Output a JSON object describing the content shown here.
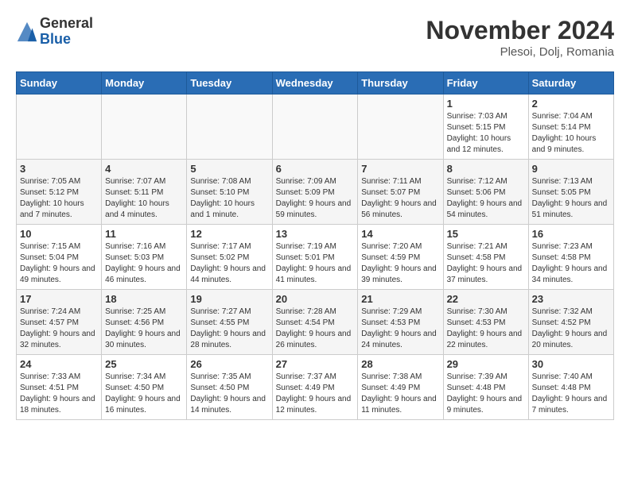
{
  "logo": {
    "general": "General",
    "blue": "Blue"
  },
  "title": "November 2024",
  "location": "Plesoi, Dolj, Romania",
  "days_of_week": [
    "Sunday",
    "Monday",
    "Tuesday",
    "Wednesday",
    "Thursday",
    "Friday",
    "Saturday"
  ],
  "weeks": [
    [
      {
        "day": "",
        "info": ""
      },
      {
        "day": "",
        "info": ""
      },
      {
        "day": "",
        "info": ""
      },
      {
        "day": "",
        "info": ""
      },
      {
        "day": "",
        "info": ""
      },
      {
        "day": "1",
        "info": "Sunrise: 7:03 AM\nSunset: 5:15 PM\nDaylight: 10 hours and 12 minutes."
      },
      {
        "day": "2",
        "info": "Sunrise: 7:04 AM\nSunset: 5:14 PM\nDaylight: 10 hours and 9 minutes."
      }
    ],
    [
      {
        "day": "3",
        "info": "Sunrise: 7:05 AM\nSunset: 5:12 PM\nDaylight: 10 hours and 7 minutes."
      },
      {
        "day": "4",
        "info": "Sunrise: 7:07 AM\nSunset: 5:11 PM\nDaylight: 10 hours and 4 minutes."
      },
      {
        "day": "5",
        "info": "Sunrise: 7:08 AM\nSunset: 5:10 PM\nDaylight: 10 hours and 1 minute."
      },
      {
        "day": "6",
        "info": "Sunrise: 7:09 AM\nSunset: 5:09 PM\nDaylight: 9 hours and 59 minutes."
      },
      {
        "day": "7",
        "info": "Sunrise: 7:11 AM\nSunset: 5:07 PM\nDaylight: 9 hours and 56 minutes."
      },
      {
        "day": "8",
        "info": "Sunrise: 7:12 AM\nSunset: 5:06 PM\nDaylight: 9 hours and 54 minutes."
      },
      {
        "day": "9",
        "info": "Sunrise: 7:13 AM\nSunset: 5:05 PM\nDaylight: 9 hours and 51 minutes."
      }
    ],
    [
      {
        "day": "10",
        "info": "Sunrise: 7:15 AM\nSunset: 5:04 PM\nDaylight: 9 hours and 49 minutes."
      },
      {
        "day": "11",
        "info": "Sunrise: 7:16 AM\nSunset: 5:03 PM\nDaylight: 9 hours and 46 minutes."
      },
      {
        "day": "12",
        "info": "Sunrise: 7:17 AM\nSunset: 5:02 PM\nDaylight: 9 hours and 44 minutes."
      },
      {
        "day": "13",
        "info": "Sunrise: 7:19 AM\nSunset: 5:01 PM\nDaylight: 9 hours and 41 minutes."
      },
      {
        "day": "14",
        "info": "Sunrise: 7:20 AM\nSunset: 4:59 PM\nDaylight: 9 hours and 39 minutes."
      },
      {
        "day": "15",
        "info": "Sunrise: 7:21 AM\nSunset: 4:58 PM\nDaylight: 9 hours and 37 minutes."
      },
      {
        "day": "16",
        "info": "Sunrise: 7:23 AM\nSunset: 4:58 PM\nDaylight: 9 hours and 34 minutes."
      }
    ],
    [
      {
        "day": "17",
        "info": "Sunrise: 7:24 AM\nSunset: 4:57 PM\nDaylight: 9 hours and 32 minutes."
      },
      {
        "day": "18",
        "info": "Sunrise: 7:25 AM\nSunset: 4:56 PM\nDaylight: 9 hours and 30 minutes."
      },
      {
        "day": "19",
        "info": "Sunrise: 7:27 AM\nSunset: 4:55 PM\nDaylight: 9 hours and 28 minutes."
      },
      {
        "day": "20",
        "info": "Sunrise: 7:28 AM\nSunset: 4:54 PM\nDaylight: 9 hours and 26 minutes."
      },
      {
        "day": "21",
        "info": "Sunrise: 7:29 AM\nSunset: 4:53 PM\nDaylight: 9 hours and 24 minutes."
      },
      {
        "day": "22",
        "info": "Sunrise: 7:30 AM\nSunset: 4:53 PM\nDaylight: 9 hours and 22 minutes."
      },
      {
        "day": "23",
        "info": "Sunrise: 7:32 AM\nSunset: 4:52 PM\nDaylight: 9 hours and 20 minutes."
      }
    ],
    [
      {
        "day": "24",
        "info": "Sunrise: 7:33 AM\nSunset: 4:51 PM\nDaylight: 9 hours and 18 minutes."
      },
      {
        "day": "25",
        "info": "Sunrise: 7:34 AM\nSunset: 4:50 PM\nDaylight: 9 hours and 16 minutes."
      },
      {
        "day": "26",
        "info": "Sunrise: 7:35 AM\nSunset: 4:50 PM\nDaylight: 9 hours and 14 minutes."
      },
      {
        "day": "27",
        "info": "Sunrise: 7:37 AM\nSunset: 4:49 PM\nDaylight: 9 hours and 12 minutes."
      },
      {
        "day": "28",
        "info": "Sunrise: 7:38 AM\nSunset: 4:49 PM\nDaylight: 9 hours and 11 minutes."
      },
      {
        "day": "29",
        "info": "Sunrise: 7:39 AM\nSunset: 4:48 PM\nDaylight: 9 hours and 9 minutes."
      },
      {
        "day": "30",
        "info": "Sunrise: 7:40 AM\nSunset: 4:48 PM\nDaylight: 9 hours and 7 minutes."
      }
    ]
  ]
}
